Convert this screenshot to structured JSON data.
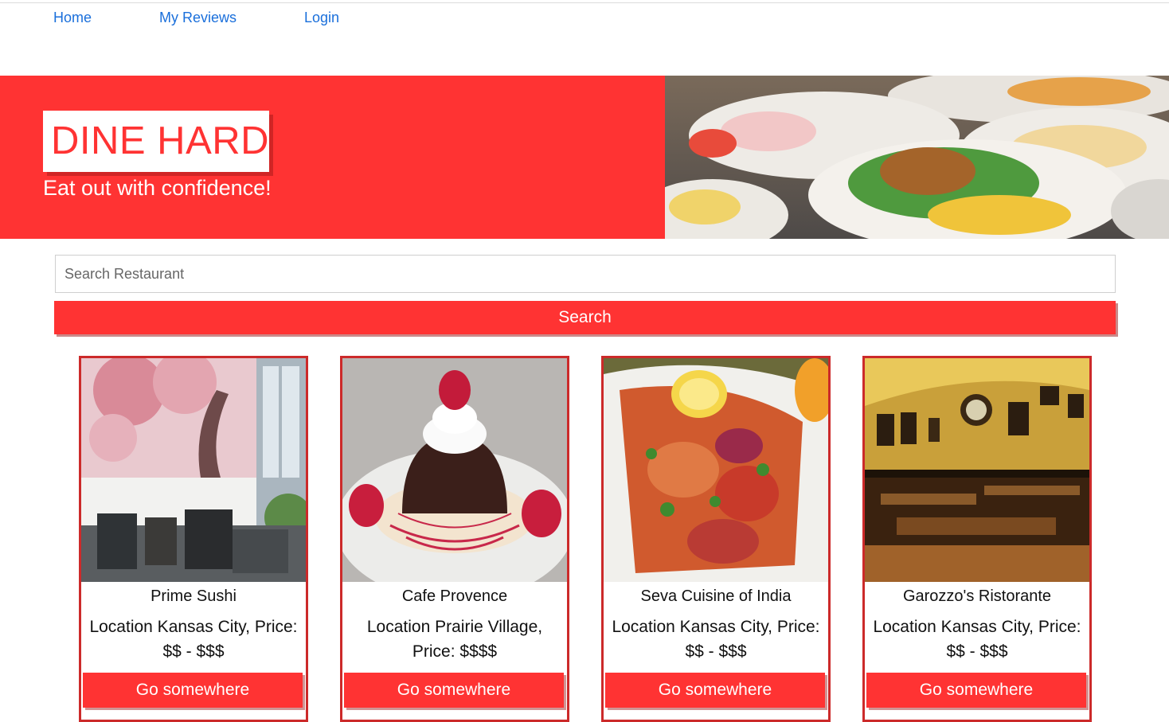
{
  "nav": {
    "items": [
      {
        "label": "Home"
      },
      {
        "label": "My Reviews"
      },
      {
        "label": "Login"
      }
    ]
  },
  "hero": {
    "title": "DINE HARD",
    "tagline": "Eat out with confidence!"
  },
  "search": {
    "placeholder": "Search Restaurant",
    "value": "",
    "button_label": "Search"
  },
  "restaurants": [
    {
      "name": "Prime Sushi",
      "location": "Location Kansas City, Price: $$ - $$$",
      "button_label": "Go somewhere"
    },
    {
      "name": "Cafe Provence",
      "location": "Location Prairie Village, Price: $$$$",
      "button_label": "Go somewhere"
    },
    {
      "name": "Seva Cuisine of India",
      "location": "Location Kansas City, Price: $$ - $$$",
      "button_label": "Go somewhere"
    },
    {
      "name": "Garozzo's Ristorante",
      "location": "Location Kansas City, Price: $$ - $$$",
      "button_label": "Go somewhere"
    }
  ],
  "colors": {
    "brand_red": "#ff3333",
    "link_blue": "#1a6fdb",
    "card_border": "#cc2a2a"
  }
}
